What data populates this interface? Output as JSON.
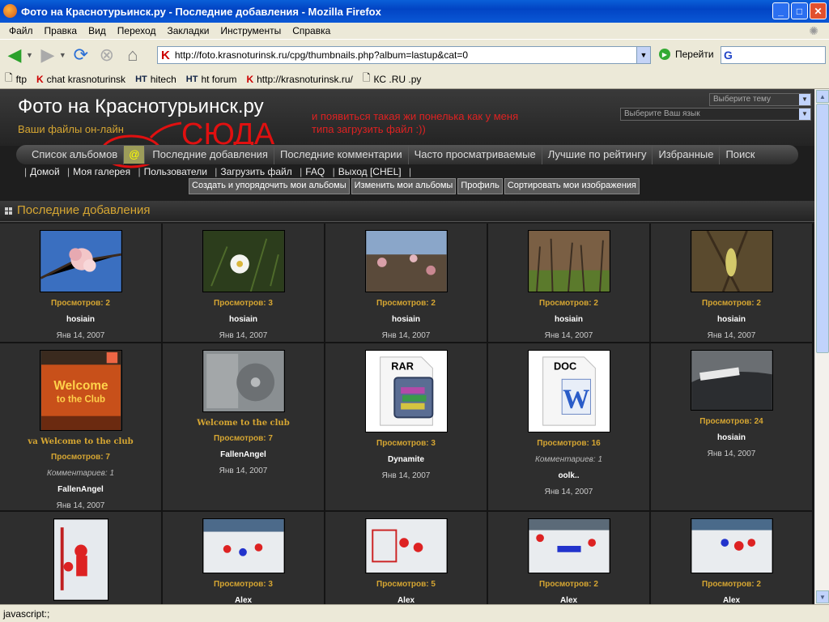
{
  "window": {
    "title": "Фото на Краснотурьинск.ру - Последние добавления - Mozilla Firefox",
    "min": "_",
    "max": "□",
    "close": "✕"
  },
  "menu": [
    "Файл",
    "Правка",
    "Вид",
    "Переход",
    "Закладки",
    "Инструменты",
    "Справка"
  ],
  "nav": {
    "url": "http://foto.krasnoturinsk.ru/cpg/thumbnails.php?album=lastup&cat=0",
    "go": "Перейти",
    "search_logo": "G"
  },
  "bookmarks": [
    {
      "icon": "page-icon",
      "label": "ftp"
    },
    {
      "icon": "k-icon",
      "label": "chat krasnoturinsk"
    },
    {
      "icon": "ht-icon",
      "label": "hitech"
    },
    {
      "icon": "ht-icon",
      "label": "ht forum"
    },
    {
      "icon": "k-icon",
      "label": "http://krasnoturinsk.ru/"
    },
    {
      "icon": "page-icon",
      "label": "КС .RU .py"
    }
  ],
  "site": {
    "title": "Фото на Краснотурьинск.ру",
    "subtitle": "Ваши файлы он-лайн",
    "theme_select": "Выберите тему",
    "lang_select": "Выберите Ваш язык",
    "annotation_big": "СЮДА",
    "annotation_line1": "и появиться такая жи понелька как у меня",
    "annotation_line2": "типа загрузить файл :))"
  },
  "tabs": [
    {
      "label": "Список альбомов"
    },
    {
      "label": "@"
    },
    {
      "label": "Последние добавления"
    },
    {
      "label": "Последние комментарии"
    },
    {
      "label": "Часто просматриваемые"
    },
    {
      "label": "Лучшие по рейтингу"
    },
    {
      "label": "Избранные"
    },
    {
      "label": "Поиск"
    }
  ],
  "sublinks": [
    "Домой",
    "Моя галерея",
    "Пользователи",
    "Загрузить файл",
    "FAQ",
    "Выход [CHEL]"
  ],
  "album_buttons": [
    "Создать и упорядочить мои альбомы",
    "Изменить мои альбомы",
    "Профиль",
    "Сортировать мои изображения"
  ],
  "section": {
    "title": "Последние добавления"
  },
  "rows": [
    [
      {
        "thumb": "blossom",
        "views": "Просмотров: 2",
        "owner": "hosiain",
        "date": "Янв 14, 2007"
      },
      {
        "thumb": "daisy",
        "views": "Просмотров: 3",
        "owner": "hosiain",
        "date": "Янв 14, 2007"
      },
      {
        "thumb": "bushes",
        "views": "Просмотров: 2",
        "owner": "hosiain",
        "date": "Янв 14, 2007"
      },
      {
        "thumb": "grass",
        "views": "Просмотров: 2",
        "owner": "hosiain",
        "date": "Янв 14, 2007"
      },
      {
        "thumb": "catkin",
        "views": "Просмотров: 2",
        "owner": "hosiain",
        "date": "Янв 14, 2007"
      }
    ],
    [
      {
        "thumb": "cd-cover",
        "title": "va Welcome to the club",
        "views": "Просмотров: 7",
        "comments": "Комментариев: 1",
        "owner": "FallenAngel",
        "date": "Янв 14, 2007"
      },
      {
        "thumb": "cd-back",
        "title": "Welcome to the club",
        "views": "Просмотров: 7",
        "owner": "FallenAngel",
        "date": "Янв 14, 2007"
      },
      {
        "thumb": "rar",
        "views": "Просмотров: 3",
        "owner": "Dynamite",
        "date": "Янв 14, 2007"
      },
      {
        "thumb": "doc",
        "views": "Просмотров: 16",
        "comments": "Комментариев: 1",
        "owner": "oolk..",
        "date": "Янв 14, 2007"
      },
      {
        "thumb": "car",
        "views": "Просмотров: 24",
        "owner": "hosiain",
        "date": "Янв 14, 2007"
      }
    ],
    [
      {
        "thumb": "hockey1",
        "views": "",
        "owner": "",
        "date": ""
      },
      {
        "thumb": "hockey2",
        "views": "Просмотров: 3",
        "owner": "Alex",
        "date": ""
      },
      {
        "thumb": "hockey3",
        "views": "Просмотров: 5",
        "owner": "Alex",
        "date": ""
      },
      {
        "thumb": "hockey4",
        "views": "Просмотров: 2",
        "owner": "Alex",
        "date": ""
      },
      {
        "thumb": "hockey5",
        "views": "Просмотров: 2",
        "owner": "Alex",
        "date": ""
      }
    ]
  ],
  "status": "javascript:;"
}
